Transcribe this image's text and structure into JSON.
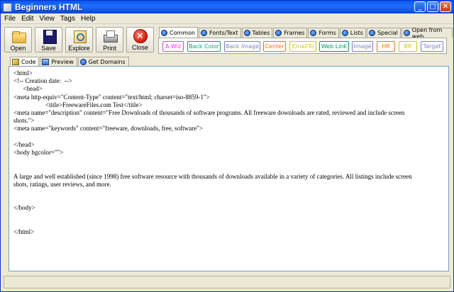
{
  "window": {
    "title": "Beginners HTML"
  },
  "menu": [
    "File",
    "Edit",
    "View",
    "Tags",
    "Help"
  ],
  "toolbar": [
    {
      "label": "Open",
      "icon": "folder-icon"
    },
    {
      "label": "Save",
      "icon": "disk-icon"
    },
    {
      "label": "Explore",
      "icon": "explore-icon"
    },
    {
      "label": "Print",
      "icon": "printer-icon"
    },
    {
      "label": "Close",
      "icon": "close-icon"
    }
  ],
  "tag_tabs": [
    "Common",
    "Fonts/Text",
    "Tables",
    "Frames",
    "Forms",
    "Lists",
    "Special",
    "Open from web"
  ],
  "active_tag_tab": "Common",
  "tag_buttons": [
    {
      "label": "A-Wiz",
      "color": "#e040e0"
    },
    {
      "label": "Back Color",
      "color": "#1a9a7a"
    },
    {
      "label": "Back Image",
      "color": "#7a7fd0"
    },
    {
      "label": "Center",
      "color": "#e07a1a"
    },
    {
      "label": "EmailTo",
      "color": "#c8c81a"
    },
    {
      "label": "Web Link",
      "color": "#1a8a6a"
    },
    {
      "label": "Image",
      "color": "#7a7fd0"
    },
    {
      "label": "HR",
      "color": "#e07a1a"
    },
    {
      "label": "BR",
      "color": "#c8c81a"
    },
    {
      "label": "Target",
      "color": "#7a7fd0"
    }
  ],
  "view_tabs": [
    {
      "label": "Code",
      "icon": "code-icon"
    },
    {
      "label": "Preview",
      "icon": "preview-icon"
    },
    {
      "label": "Get Domains",
      "icon": "globe-icon"
    }
  ],
  "active_view_tab": "Code",
  "editor_lines": [
    "<html>",
    "<!-- Creation date:  -->",
    "      <head>",
    "<meta http-equiv=\"Content-Type\" content=\"text/html; charset=iso-8859-1\">",
    "                    <title>FreewareFiles.com Test</title>",
    "<meta name=\"description\" content=\"Free Downloads of thousands of software programs. All freeware downloads are rated, reviewed and include screen",
    "shots.\">",
    "<meta name=\"keywords\" content=\"freeware, downloads, free, software\">",
    "",
    "</head>",
    "<body bgcolor=\"\">",
    "",
    "",
    "A large and well established (since 1998) free software resource with thousands of downloads available in a variety of categories. All listings include screen",
    "shots, ratings, user reviews, and more.",
    "",
    "",
    "</body>",
    "",
    "",
    "</html>"
  ]
}
